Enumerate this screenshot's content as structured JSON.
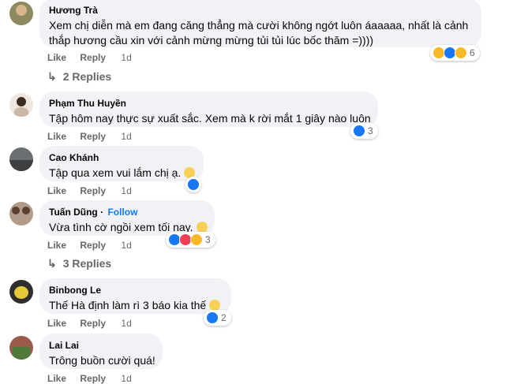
{
  "actions": {
    "like": "Like",
    "reply": "Reply"
  },
  "comments": [
    {
      "author": "Hương Trà",
      "text1": "Xem chị diễn mà em đang căng thẳng mà cười không ngớt luôn áaaaaa, nhất là cảnh",
      "text2": "thắp hương cầu xin với cảnh mừng mừng tủi tủi lúc bốc thăm =))))",
      "time": "1d",
      "reaction_count": "6",
      "reactions": [
        "haha",
        "like",
        "care"
      ],
      "replies": "2 Replies"
    },
    {
      "author": "Phạm Thu Huyền",
      "text": "Tập hôm nay thực sự xuất sắc. Xem mà k rời mắt 1 giây nào luôn",
      "time": "1d",
      "reaction_count": "3",
      "reactions": [
        "like"
      ]
    },
    {
      "author": "Cao Khánh",
      "text": "Tập qua xem vui lắm chị ạ.",
      "time": "1d",
      "reactions": [
        "like"
      ]
    },
    {
      "author": "Tuấn Dũng",
      "follow": "Follow",
      "text": "Vừa tình cờ ngồi xem tối nay.",
      "time": "1d",
      "reaction_count": "3",
      "reactions": [
        "like",
        "love",
        "care"
      ],
      "replies": "3 Replies"
    },
    {
      "author": "Binbong Le",
      "text": "Thế Hà định làm rì 3 báo kia thế",
      "time": "1d",
      "reaction_count": "2",
      "reactions": [
        "like"
      ]
    },
    {
      "author": "Lai Lai",
      "text": "Trông buồn cười quá!",
      "time": "1d"
    }
  ]
}
